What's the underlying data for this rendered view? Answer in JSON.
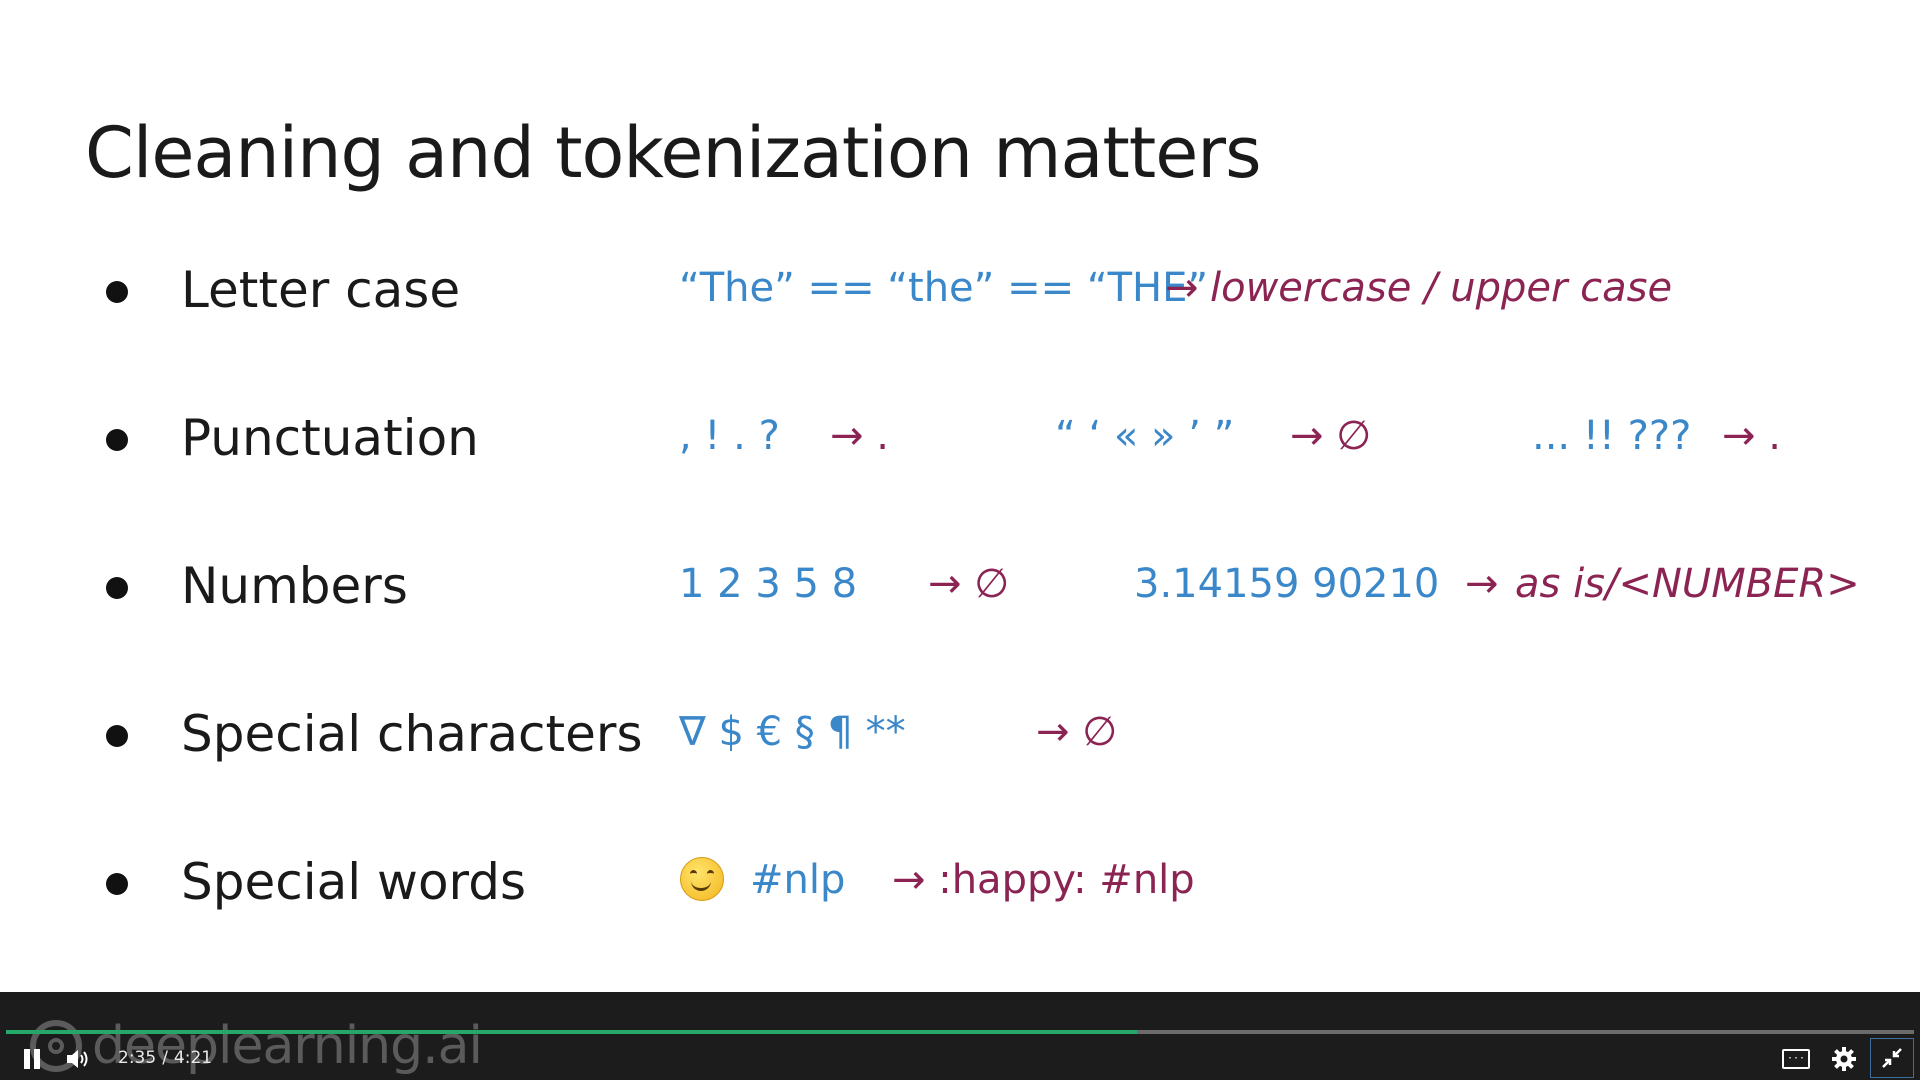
{
  "slide": {
    "title": "Cleaning and tokenization matters",
    "rows": [
      {
        "label": "Letter case",
        "examples": [
          {
            "text": "“The” == “the” == “THE”",
            "color": "#3a87c9"
          },
          {
            "text": "→",
            "color": "#8b2452"
          },
          {
            "text": "lowercase / upper case",
            "color": "#8b2452",
            "italic": true
          }
        ]
      },
      {
        "label": "Punctuation",
        "examples": [
          {
            "text": ", ! . ?",
            "color": "#3a87c9"
          },
          {
            "text": "→ .",
            "color": "#8b2452"
          },
          {
            "text": "“ ‘ « » ’ ”",
            "color": "#3a87c9"
          },
          {
            "text": "→ ∅",
            "color": "#8b2452"
          },
          {
            "text": "... !! ???",
            "color": "#3a87c9"
          },
          {
            "text": "→ .",
            "color": "#8b2452"
          }
        ]
      },
      {
        "label": "Numbers",
        "examples": [
          {
            "text": "1 2 3 5 8",
            "color": "#3a87c9"
          },
          {
            "text": "→ ∅",
            "color": "#8b2452"
          },
          {
            "text": "3.14159 90210",
            "color": "#3a87c9"
          },
          {
            "text": "→",
            "color": "#8b2452"
          },
          {
            "text": "as is/<NUMBER>",
            "color": "#8b2452",
            "italic": true
          }
        ]
      },
      {
        "label": "Special characters",
        "examples": [
          {
            "text": "∇ $ € § ¶ **",
            "color": "#3a87c9"
          },
          {
            "text": "→ ∅",
            "color": "#8b2452"
          }
        ]
      },
      {
        "label": "Special words",
        "examples": [
          {
            "icon": "smiley-emoji-icon"
          },
          {
            "text": "#nlp",
            "color": "#3a87c9"
          },
          {
            "text": "→ :happy: #nlp",
            "color": "#8b2452"
          }
        ]
      }
    ]
  },
  "player": {
    "watermark": "deeplearning.ai",
    "current_time": "2:35",
    "separator": "/",
    "duration": "4:21",
    "progress_fraction": 0.593,
    "progress_color": "#24a86a",
    "icons": [
      "pause-icon",
      "volume-icon",
      "captions-icon",
      "gear-icon",
      "exit-fullscreen-icon"
    ]
  }
}
